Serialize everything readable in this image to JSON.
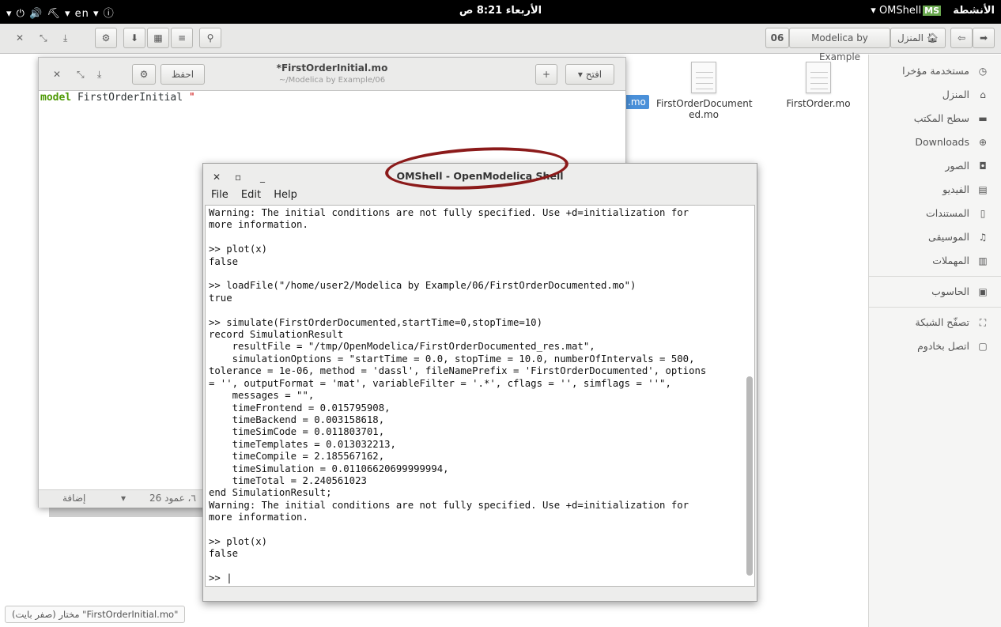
{
  "topbar": {
    "activities": "الأنشطة",
    "app_name": "OMShell",
    "app_badge": "MS",
    "clock": "الأربعاء 8:21 ص",
    "left_indicators": "▾ ⏻ 🔊 ⛏   ▾ en   ▾ ⓘ"
  },
  "nautilus": {
    "path_segment_number": "06",
    "path_segment": "Modelica by Example",
    "path_home": "المنزل",
    "files": [
      {
        "name": "FirstOrder.mo"
      },
      {
        "name": "FirstOrderDocument ed.mo"
      }
    ],
    "selected_file_fragment": ".mo",
    "status": "\"FirstOrderInitial.mo\" مختار (صفر بايت)"
  },
  "sidebar": {
    "items": [
      {
        "label": "مستخدمة مؤخرا",
        "icon": "clock-icon"
      },
      {
        "label": "المنزل",
        "icon": "home-icon"
      },
      {
        "label": "سطح المكتب",
        "icon": "desktop-icon"
      },
      {
        "label": "Downloads",
        "icon": "download-icon"
      },
      {
        "label": "الصور",
        "icon": "camera-icon"
      },
      {
        "label": "الفيديو",
        "icon": "film-icon"
      },
      {
        "label": "المستندات",
        "icon": "document-icon"
      },
      {
        "label": "الموسيقى",
        "icon": "music-icon"
      },
      {
        "label": "المهملات",
        "icon": "trash-icon"
      },
      {
        "label": "الحاسوب",
        "icon": "computer-icon"
      },
      {
        "label": "تصفّح الشبكة",
        "icon": "network-icon"
      },
      {
        "label": "اتصل بخادوم",
        "icon": "server-icon"
      }
    ]
  },
  "gedit": {
    "title": "*FirstOrderInitial.mo",
    "subtitle": "~/Modelica by Example/06",
    "open_label": "افتح",
    "save_label": "احفظ",
    "code_keyword": "model",
    "code_name": " FirstOrderInitial ",
    "code_string": "\"",
    "status_position": "٦، عمود 26",
    "status_insert": "إضافة"
  },
  "omshell": {
    "title": "OMShell - OpenModelica Shell",
    "menu": [
      "File",
      "Edit",
      "Help"
    ],
    "console_text": "Warning: The initial conditions are not fully specified. Use +d=initialization for\nmore information.\n\n>> plot(x)\nfalse\n\n>> loadFile(\"/home/user2/Modelica by Example/06/FirstOrderDocumented.mo\")\ntrue\n\n>> simulate(FirstOrderDocumented,startTime=0,stopTime=10)\nrecord SimulationResult\n    resultFile = \"/tmp/OpenModelica/FirstOrderDocumented_res.mat\",\n    simulationOptions = \"startTime = 0.0, stopTime = 10.0, numberOfIntervals = 500,\ntolerance = 1e-06, method = 'dassl', fileNamePrefix = 'FirstOrderDocumented', options\n= '', outputFormat = 'mat', variableFilter = '.*', cflags = '', simflags = ''\",\n    messages = \"\",\n    timeFrontend = 0.015795908,\n    timeBackend = 0.003158618,\n    timeSimCode = 0.011803701,\n    timeTemplates = 0.013032213,\n    timeCompile = 2.185567162,\n    timeSimulation = 0.01106620699999994,\n    timeTotal = 2.240561023\nend SimulationResult;\nWarning: The initial conditions are not fully specified. Use +d=initialization for\nmore information.\n\n>> plot(x)\nfalse\n\n>> |"
  },
  "colors": {
    "annotation_circle": "#8b1a1a",
    "selection": "#4a90d9",
    "keyword": "#4e9a06"
  }
}
